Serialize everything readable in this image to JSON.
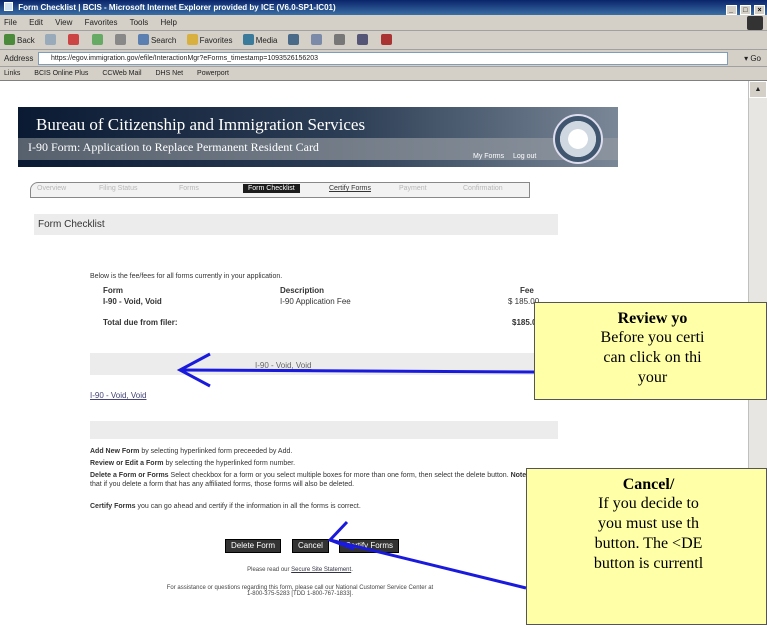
{
  "browser": {
    "title": "Form Checklist | BCIS - Microsoft Internet Explorer provided by ICE (V6.0-SP1-IC01)",
    "window_buttons": [
      "_",
      "□",
      "×"
    ],
    "menu": [
      "File",
      "Edit",
      "View",
      "Favorites",
      "Tools",
      "Help"
    ],
    "toolbar": {
      "back": "Back",
      "search": "Search",
      "favorites": "Favorites",
      "media": "Media"
    },
    "address_label": "Address",
    "address_url": "https://egov.immigration.gov/efile/InteractionMgr?eForms_timestamp=1093526156203",
    "go_label": "Go",
    "links_label": "Links",
    "links": [
      "BCIS Online Plus",
      "CCWeb Mail",
      "DHS Net",
      "Powerport"
    ]
  },
  "header": {
    "org": "Bureau of Citizenship and Immigration Services",
    "subtitle": "I-90 Form: Application to Replace Permanent Resident Card",
    "my_forms": "My Forms",
    "log_out": "Log out"
  },
  "tabs": [
    {
      "label": "Overview",
      "state": "disabled"
    },
    {
      "label": "Filing Status",
      "state": "disabled"
    },
    {
      "label": "Forms",
      "state": "disabled"
    },
    {
      "label": "Form Checklist",
      "state": "active"
    },
    {
      "label": "Certify Forms",
      "state": "link"
    },
    {
      "label": "Payment",
      "state": "disabled"
    },
    {
      "label": "Confirmation",
      "state": "disabled"
    }
  ],
  "checklist": {
    "heading": "Form Checklist",
    "intro": "Below is the fee/fees for all forms currently in your application.",
    "columns": {
      "form": "Form",
      "description": "Description",
      "fee": "Fee"
    },
    "rows": [
      {
        "form": "I-90 - Void, Void",
        "description": "I-90 Application Fee",
        "fee": "$ 185.00"
      }
    ],
    "total_label": "Total due from filer:",
    "total_value": "$185.00",
    "form_group_title": "I-90 - Void, Void",
    "form_link": "I-90 - Void, Void"
  },
  "help": {
    "add_bold": "Add New Form",
    "add_text": " by selecting hyperlinked form preceeded by Add.",
    "edit_bold": "Review or Edit a Form",
    "edit_text": " by selecting the hyperlinked form number.",
    "delete_bold": "Delete a Form or Forms",
    "delete_text": " Select checkbox for a form or you select multiple boxes for more than one form, then select the delete button. ",
    "note_bold": "Note:",
    "note_text": " that if you delete a form that has any affiliated forms, those forms will also be deleted.",
    "certify_bold": "Certify Forms",
    "certify_text": " you can go ahead and certify if the information in all the forms is correct."
  },
  "buttons": {
    "delete": "Delete Form",
    "cancel": "Cancel",
    "certify": "Certify Forms"
  },
  "footer": {
    "secure_prefix": "Please read our ",
    "secure_link": "Secure Site Statement",
    "secure_suffix": ".",
    "assist_line1": "For assistance or questions regarding this form, please call our National Customer Service Center at",
    "assist_line2": "1-800-375-5283 [TDD 1-800-767-1833]."
  },
  "callouts": {
    "review": {
      "title": "Review yo",
      "lines": [
        "Before you certi",
        "can click on thi",
        "your"
      ]
    },
    "cancel": {
      "title": "Cancel/",
      "lines": [
        "If you decide to",
        "you must use th",
        "button.  The <DE",
        "button is currentl"
      ]
    }
  },
  "colors": {
    "callout_bg": "#ffffa8",
    "arrow": "#1a1adc",
    "banner_dark": "#0b1a33"
  }
}
